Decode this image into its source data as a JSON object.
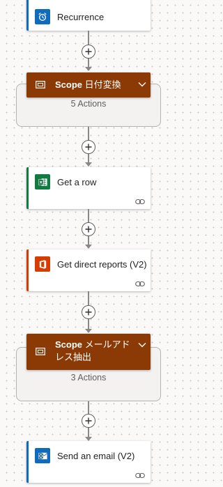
{
  "flow": {
    "recurrence": {
      "title": "Recurrence",
      "icon": "alarm-clock-icon",
      "color": "#0f6cbd"
    },
    "scope1": {
      "label": "Scope",
      "suffix": "日付変換",
      "actions": "5 Actions",
      "color": "#8c3a05"
    },
    "get_row": {
      "title": "Get a row",
      "icon": "excel-icon",
      "color": "#107c41"
    },
    "get_reports": {
      "title": "Get direct reports (V2)",
      "icon": "office-icon",
      "color": "#d83b01"
    },
    "scope2": {
      "label": "Scope",
      "suffix_line1": "メールアド",
      "suffix_line2": "レス抽出",
      "actions": "3 Actions",
      "color": "#8c3a05"
    },
    "send_email": {
      "title": "Send an email (V2)",
      "icon": "outlook-icon",
      "color": "#0f6cbd"
    }
  }
}
